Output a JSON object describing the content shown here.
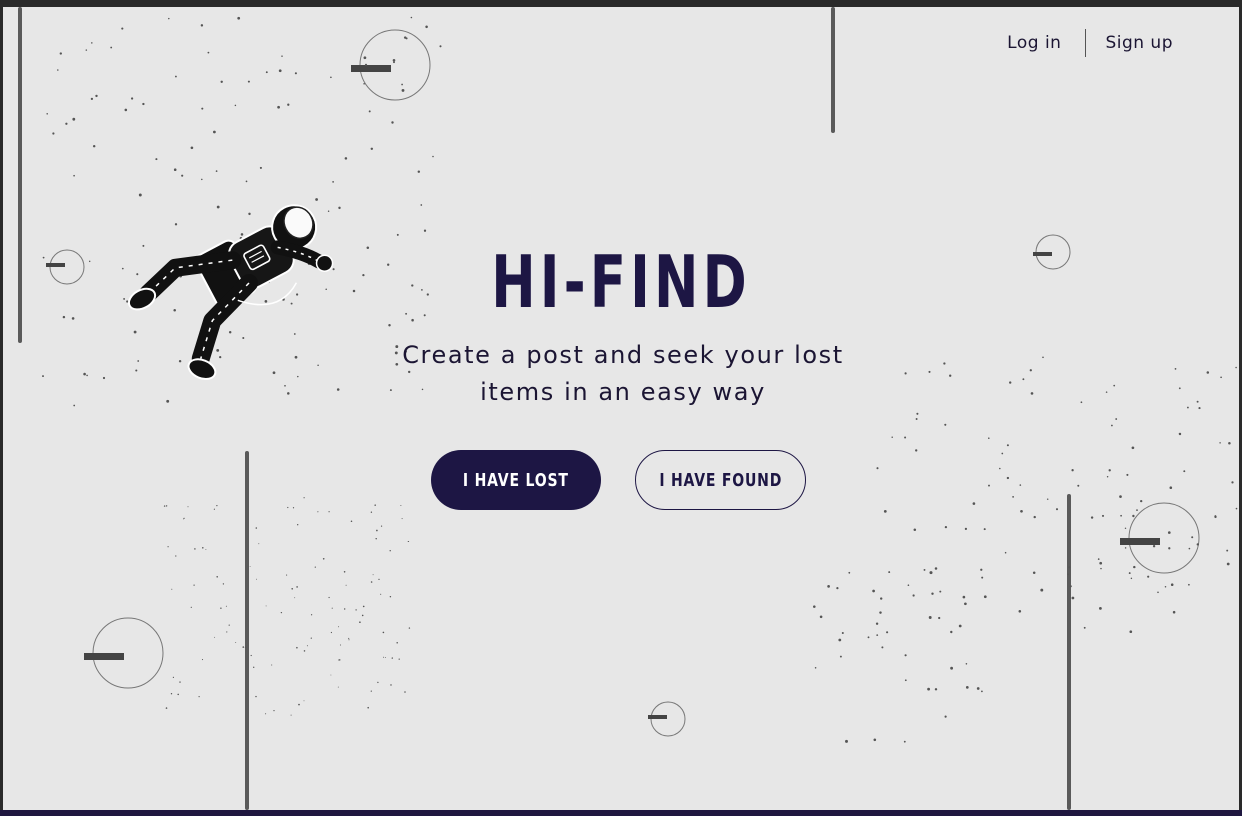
{
  "nav": {
    "login_label": "Log in",
    "signup_label": "Sign up"
  },
  "hero": {
    "title": "HI-FIND",
    "subtitle": "Create a post and seek your lost items in an easy way"
  },
  "actions": {
    "lost_label": "I HAVE LOST",
    "found_label": "I HAVE FOUND"
  },
  "theme": {
    "primary": "#1d1644",
    "background": "#e7e7e7",
    "decor": "#555555"
  },
  "illustration": {
    "icon": "astronaut-icon"
  }
}
